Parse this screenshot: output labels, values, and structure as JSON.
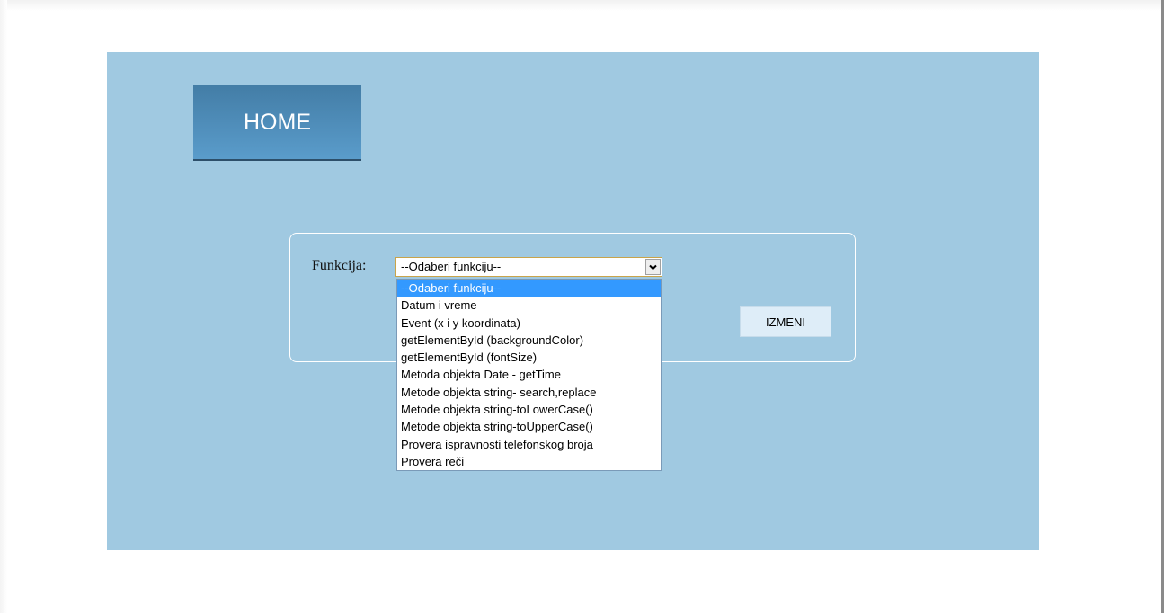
{
  "header": {
    "home_label": "HOME"
  },
  "form": {
    "function_label": "Funkcija:",
    "selected_value": "--Odaberi funkciju--",
    "submit_label": "IZMENI",
    "options": [
      "--Odaberi funkciju--",
      "Datum i vreme",
      "Event (x i y koordinata)",
      "getElementById (backgroundColor)",
      "getElementById (fontSize)",
      "Metoda objekta Date - getTime",
      "Metode objekta string- search,replace",
      "Metode objekta string-toLowerCase()",
      "Metode objekta string-toUpperCase()",
      "Provera ispravnosti telefonskog broja",
      "Provera reči"
    ],
    "highlighted_option_index": 0
  },
  "colors": {
    "panel_background": "#a0c9e1",
    "home_button_top": "#437da6",
    "home_button_bottom": "#5a9ccb",
    "option_highlight": "#3399ff",
    "submit_background": "#deedf8"
  },
  "icons": {
    "select_arrow": "chevron-down-icon"
  }
}
